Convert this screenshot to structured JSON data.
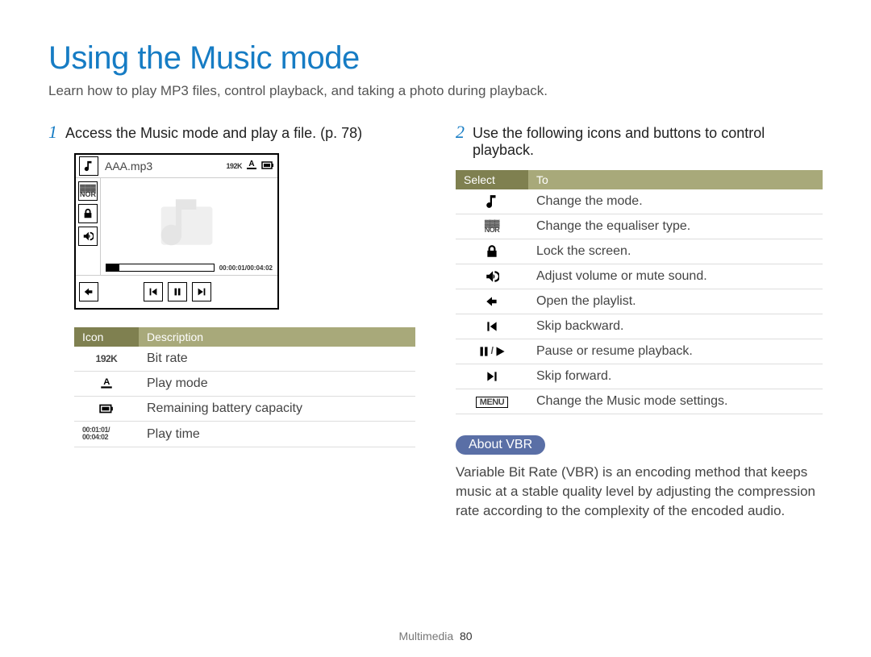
{
  "title": "Using the Music mode",
  "intro": "Learn how to play MP3 files, control playback, and taking a photo during playback.",
  "left": {
    "step_num": "1",
    "step_text": "Access the Music mode and play a file. (p. 78)",
    "player": {
      "song": "AAA.mp3",
      "bitrate_badge": "192K",
      "play_mode_badge": "A",
      "time_badge": "00:00:01/00:04:02",
      "icons": {
        "mode": "music-note-icon",
        "equaliser": "nor-icon",
        "lock": "lock-icon",
        "volume": "volume-icon",
        "back": "back-icon",
        "prev": "skip-prev-icon",
        "pause": "pause-icon",
        "next": "skip-next-icon"
      }
    },
    "table": {
      "header_icon": "Icon",
      "header_desc": "Description",
      "rows": [
        {
          "icon_text": "192K",
          "icon_kind": "text",
          "desc": "Bit rate"
        },
        {
          "icon_text": "A",
          "icon_kind": "playmode",
          "desc": "Play mode"
        },
        {
          "icon_text": "",
          "icon_kind": "battery",
          "desc": "Remaining battery capacity"
        },
        {
          "icon_text": "00:01:01/\n00:04:02",
          "icon_kind": "time",
          "desc": "Play time"
        }
      ]
    }
  },
  "right": {
    "step_num": "2",
    "step_text": "Use the following icons and buttons to control playback.",
    "table": {
      "header_select": "Select",
      "header_to": "To",
      "rows": [
        {
          "icon_kind": "note",
          "to": "Change the mode."
        },
        {
          "icon_kind": "nor",
          "to": "Change the equaliser type."
        },
        {
          "icon_kind": "lock",
          "to": "Lock the screen."
        },
        {
          "icon_kind": "volume",
          "to": "Adjust volume or mute sound."
        },
        {
          "icon_kind": "back",
          "to": "Open the playlist."
        },
        {
          "icon_kind": "prev",
          "to": "Skip backward."
        },
        {
          "icon_kind": "pauseplay",
          "to": "Pause or resume playback."
        },
        {
          "icon_kind": "next",
          "to": "Skip forward."
        },
        {
          "icon_kind": "menu",
          "to": "Change the Music mode settings."
        }
      ]
    },
    "about": {
      "pill": "About VBR",
      "text": "Variable Bit Rate (VBR) is an encoding method that keeps music at a stable quality level by adjusting the compression rate according to the complexity of the encoded audio."
    }
  },
  "footer": {
    "section": "Multimedia",
    "page": "80"
  },
  "labels": {
    "menu_box": "MENU",
    "nor": "NOR"
  }
}
